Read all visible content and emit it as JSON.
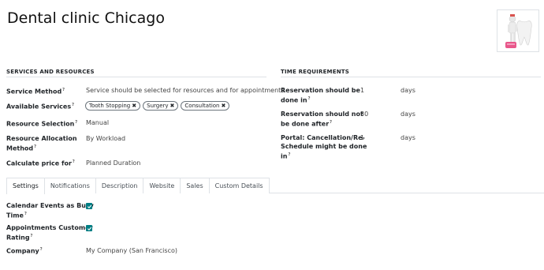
{
  "title": "Dental clinic Chicago",
  "services": {
    "section_title": "SERVICES AND RESOURCES",
    "service_method": {
      "label": "Service Method",
      "value": "Service should be selected for resources and for appointments"
    },
    "available_services": {
      "label": "Available Services",
      "tags": [
        "Tooth Stopping",
        "Surgery",
        "Consultation"
      ]
    },
    "resource_selection": {
      "label": "Resource Selection",
      "value": "Manual"
    },
    "resource_allocation": {
      "label_line1": "Resource Allocation",
      "label_line2": "Method",
      "value": "By Workload"
    },
    "calculate_price": {
      "label": "Calculate price for",
      "value": "Planned Duration"
    }
  },
  "time": {
    "section_title": "TIME REQUIREMENTS",
    "reservation_done_in": {
      "label_line1": "Reservation should be",
      "label_line2": "done in",
      "value": "1",
      "unit": "days"
    },
    "reservation_not_done_after": {
      "label_line1": "Reservation should not",
      "label_line2": "be done after",
      "value": "30",
      "unit": "days"
    },
    "portal_cancellation": {
      "label_line1": "Portal: Cancellation/Re-",
      "label_line2": "Schedule might be done",
      "label_line3": "in",
      "value": "1",
      "unit": "days"
    }
  },
  "tabs": [
    "Settings",
    "Notifications",
    "Description",
    "Website",
    "Sales",
    "Custom Details"
  ],
  "settings": {
    "calendar_busy": {
      "label_line1": "Calendar Events as Busy",
      "label_line2": "Time",
      "checked": true
    },
    "customer_rating": {
      "label_line1": "Appointments Customer",
      "label_line2": "Rating",
      "checked": true
    },
    "company": {
      "label": "Company",
      "value": "My Company (San Francisco)"
    }
  },
  "help_mark": "?",
  "colors": {
    "accent": "#017e84",
    "tag_border": "#6c757d"
  }
}
